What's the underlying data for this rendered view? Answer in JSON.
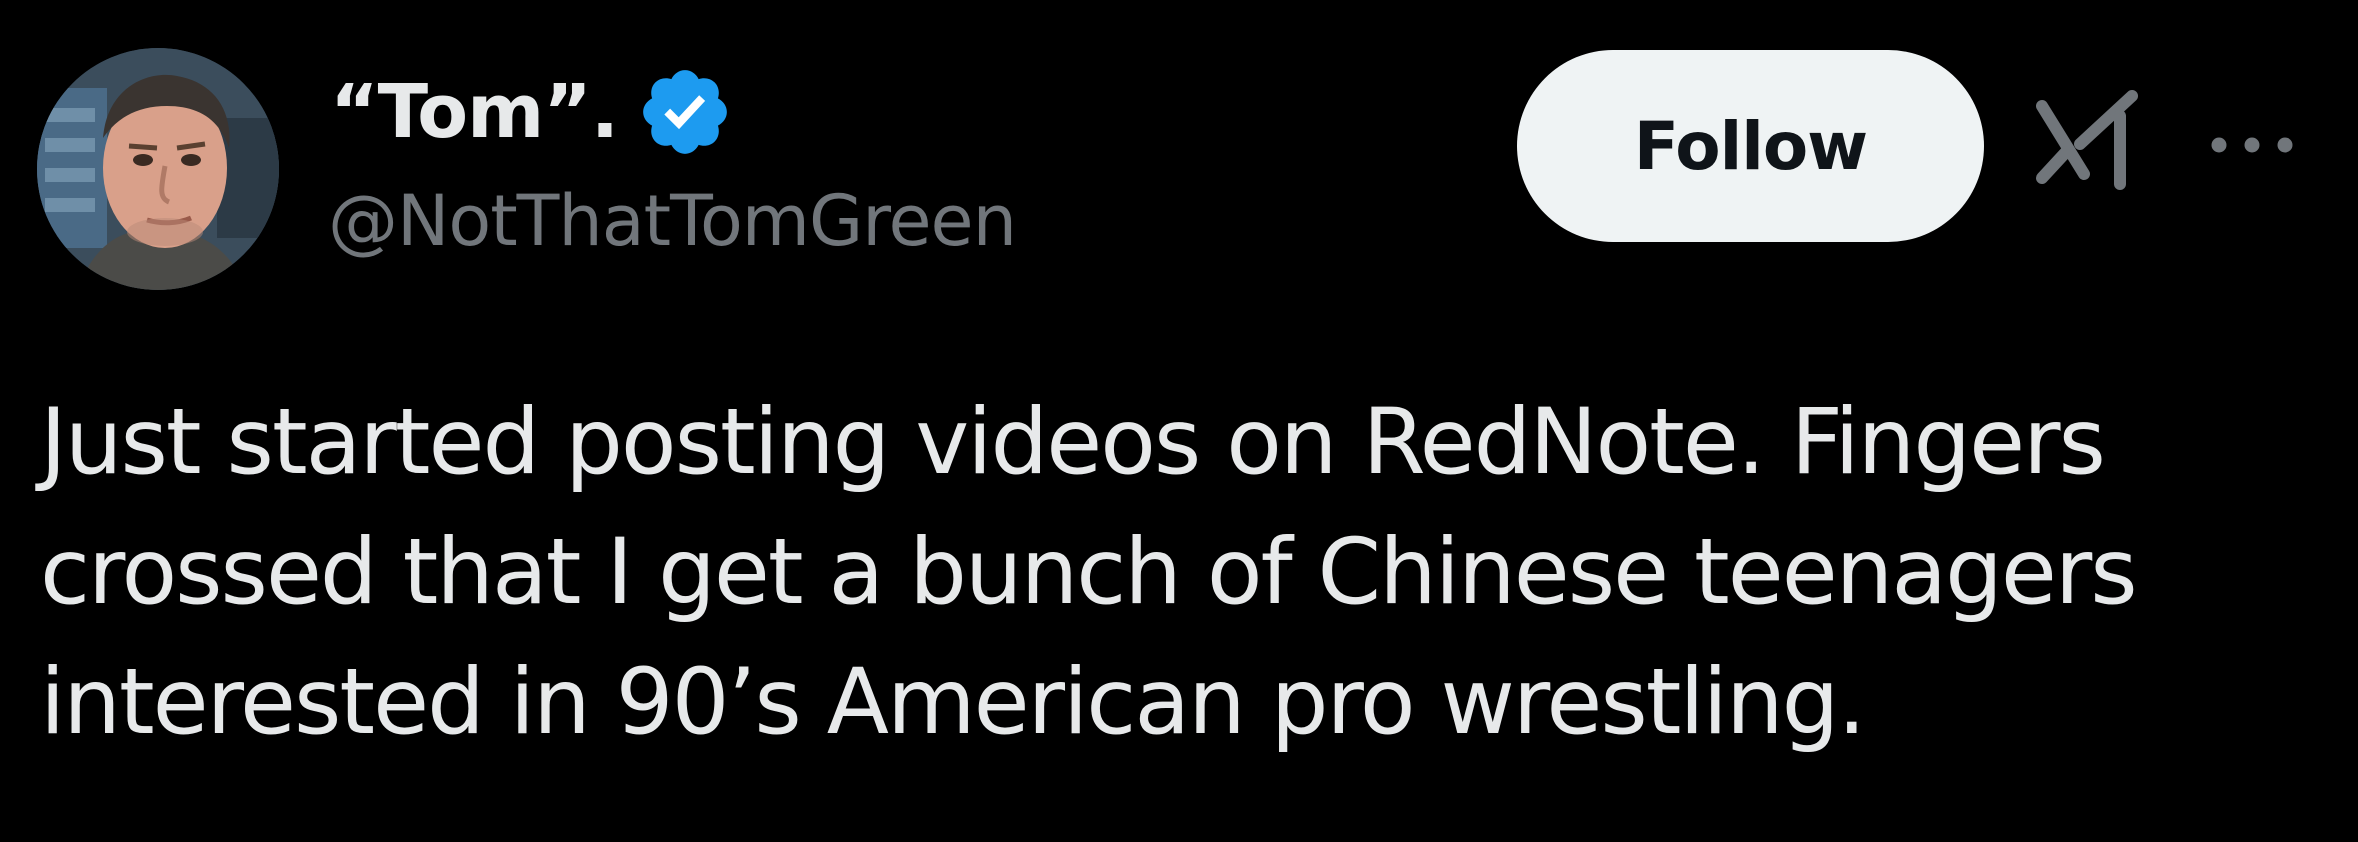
{
  "author": {
    "display_name": "“Tom”.",
    "handle": "@NotThatTomGreen",
    "verified": true,
    "avatar": "avatar-photo"
  },
  "actions": {
    "follow_label": "Follow",
    "grok_icon": "grok-icon",
    "more_icon": "more-options-icon"
  },
  "tweet": {
    "text": "Just started posting videos on RedNote. Fingers\ncrossed that I get a bunch of Chinese teenagers\ninterested in 90’s American pro wrestling."
  },
  "colors": {
    "background": "#000000",
    "text_primary": "#e7e9ea",
    "text_secondary": "#71767b",
    "verified_blue": "#1d9bf0",
    "follow_button_bg": "#eff3f4",
    "follow_button_text": "#0f1419"
  }
}
